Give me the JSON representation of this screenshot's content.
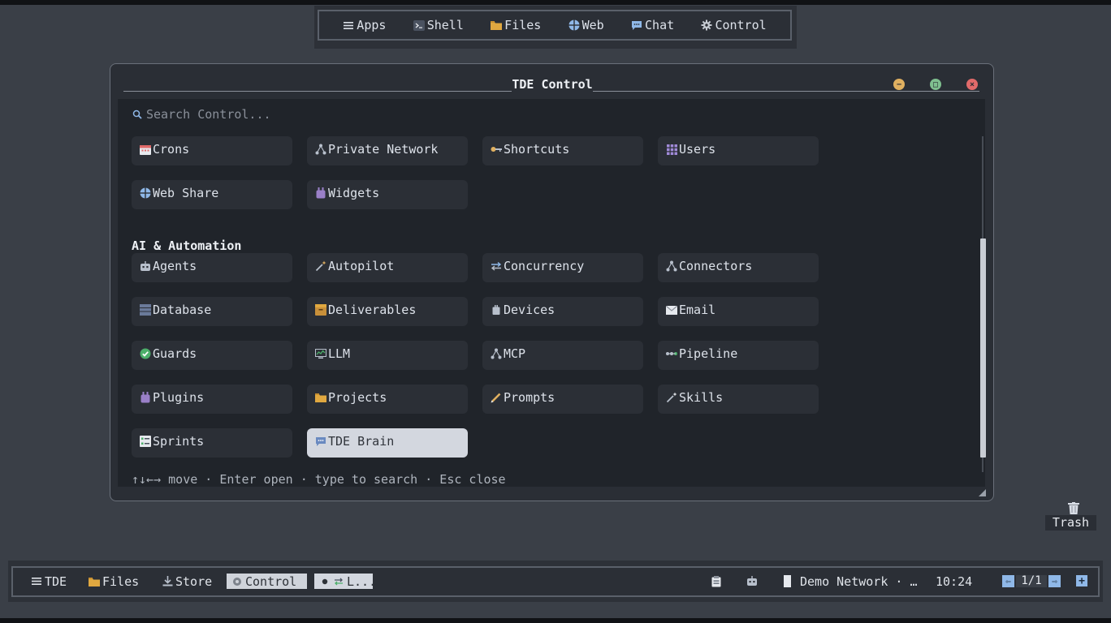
{
  "dock": {
    "items": [
      {
        "label": "Apps",
        "icon": "menu-icon"
      },
      {
        "label": "Shell",
        "icon": "terminal-icon"
      },
      {
        "label": "Files",
        "icon": "folder-icon"
      },
      {
        "label": "Web",
        "icon": "globe-icon"
      },
      {
        "label": "Chat",
        "icon": "chat-bubble-icon"
      },
      {
        "label": "Control",
        "icon": "gear-icon"
      }
    ]
  },
  "window": {
    "title": "TDE Control",
    "search_placeholder": "Search Control...",
    "section_ai": "AI & Automation",
    "hint": "↑↓←→ move · Enter open · type to search · Esc close"
  },
  "items_top": [
    {
      "label": "Crons",
      "icon": "calendar-icon"
    },
    {
      "label": "Private Network",
      "icon": "network-icon"
    },
    {
      "label": "Shortcuts",
      "icon": "key-icon"
    },
    {
      "label": "Users",
      "icon": "users-grid-icon"
    },
    {
      "label": "Web Share",
      "icon": "globe-icon"
    },
    {
      "label": "Widgets",
      "icon": "plug-icon"
    }
  ],
  "items_ai": [
    {
      "label": "Agents",
      "icon": "robot-icon"
    },
    {
      "label": "Autopilot",
      "icon": "magic-wand-icon"
    },
    {
      "label": "Concurrency",
      "icon": "arrows-exchange-icon"
    },
    {
      "label": "Connectors",
      "icon": "network-icon"
    },
    {
      "label": "Database",
      "icon": "database-icon"
    },
    {
      "label": "Deliverables",
      "icon": "package-icon"
    },
    {
      "label": "Devices",
      "icon": "device-icon"
    },
    {
      "label": "Email",
      "icon": "envelope-icon"
    },
    {
      "label": "Guards",
      "icon": "check-circle-icon"
    },
    {
      "label": "LLM",
      "icon": "chart-monitor-icon"
    },
    {
      "label": "MCP",
      "icon": "network-icon"
    },
    {
      "label": "Pipeline",
      "icon": "pipeline-icon"
    },
    {
      "label": "Plugins",
      "icon": "plug-icon"
    },
    {
      "label": "Projects",
      "icon": "folder-icon"
    },
    {
      "label": "Prompts",
      "icon": "pencil-icon"
    },
    {
      "label": "Skills",
      "icon": "magic-wand-icon"
    },
    {
      "label": "Sprints",
      "icon": "checklist-icon"
    },
    {
      "label": "TDE Brain",
      "icon": "chat-bubble-icon",
      "selected": true
    }
  ],
  "trash": {
    "label": "Trash"
  },
  "taskbar": {
    "tde": "TDE",
    "files": "Files",
    "store": "Store",
    "control": "Control",
    "ll": "L...",
    "network": "Demo Network · …",
    "clock": "10:24",
    "page": "1/1"
  },
  "colors": {
    "background": "#3a3f47",
    "window": "#2a2e35",
    "content": "#20242a",
    "tile": "#2b2f36",
    "selected_tile": "#d3d7df",
    "accent_blue": "#8fb8e8",
    "minimize": "#e0b060",
    "maximize": "#7fc08f",
    "close": "#e06a6a"
  }
}
